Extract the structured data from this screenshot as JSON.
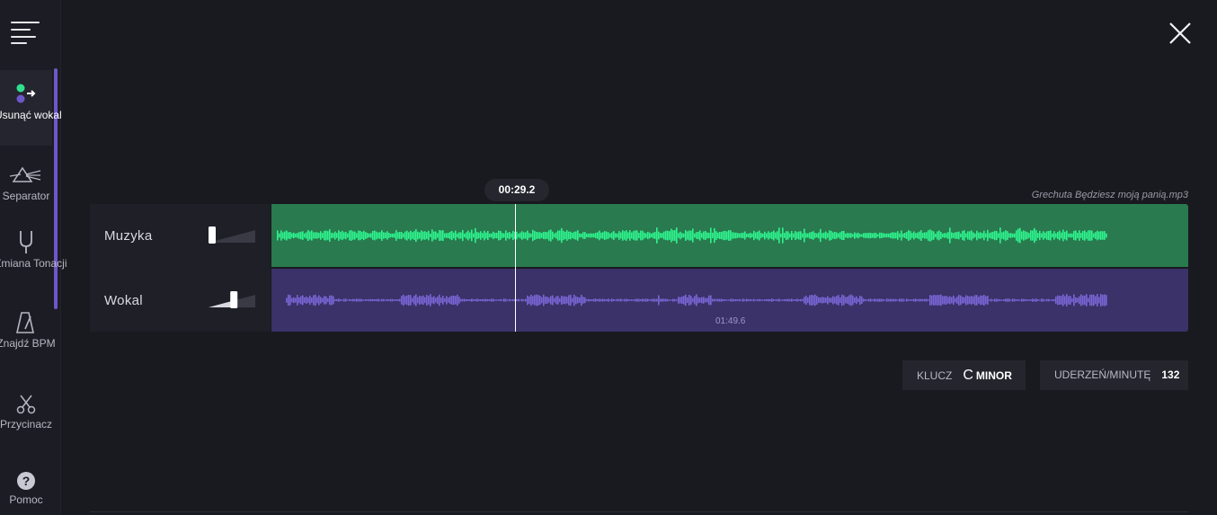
{
  "sidebar": {
    "items": [
      {
        "label": "Usunąć wokal",
        "icon": "remove-vocal-icon",
        "active": true
      },
      {
        "label": "Separator",
        "icon": "prism-icon",
        "active": false
      },
      {
        "label": "Zmiana Tonacji",
        "icon": "tuning-fork-icon",
        "active": false
      },
      {
        "label": "Znajdź BPM",
        "icon": "metronome-icon",
        "active": false
      },
      {
        "label": "Przycinacz",
        "icon": "scissors-icon",
        "active": false
      }
    ],
    "help_label": "Pomoc"
  },
  "player": {
    "current_time": "00:29.2",
    "file_name": "Grechuta Będziesz moją panią.mp3",
    "duration": "01:49.6",
    "tracks": [
      {
        "name": "Muzyka",
        "volume": 0.0,
        "color": "#2a7a4f",
        "wave_color": "#2ef58f"
      },
      {
        "name": "Wokal",
        "volume": 0.55,
        "color": "#3a3268",
        "wave_color": "#7a66d6"
      }
    ]
  },
  "info": {
    "key_label": "KLUCZ",
    "key_note": "C",
    "key_mode": "MINOR",
    "bpm_label": "UDERZEŃ/MINUTĘ",
    "bpm_value": "132"
  },
  "colors": {
    "background": "#191920",
    "accent": "#6e57c9"
  }
}
